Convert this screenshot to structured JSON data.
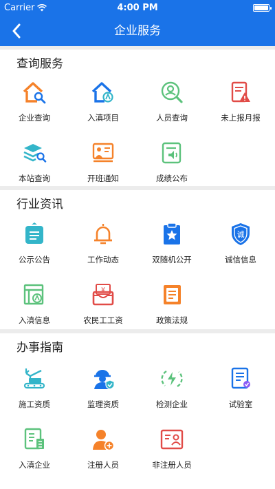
{
  "status_bar": {
    "carrier": "Carrier",
    "time": "4:00 PM"
  },
  "nav": {
    "title": "企业服务",
    "back_icon": "chevron-left-icon"
  },
  "sections": [
    {
      "title": "查询服务",
      "items": [
        {
          "label": "企业查询",
          "icon": "house-search-icon"
        },
        {
          "label": "入滇项目",
          "icon": "house-project-icon"
        },
        {
          "label": "人员查询",
          "icon": "person-search-icon"
        },
        {
          "label": "未上报月报",
          "icon": "report-alert-icon"
        },
        {
          "label": "本站查询",
          "icon": "layers-search-icon"
        },
        {
          "label": "开班通知",
          "icon": "class-board-icon"
        },
        {
          "label": "成绩公布",
          "icon": "score-announce-icon"
        }
      ]
    },
    {
      "title": "行业资讯",
      "items": [
        {
          "label": "公示公告",
          "icon": "notice-board-icon"
        },
        {
          "label": "工作动态",
          "icon": "bell-icon"
        },
        {
          "label": "双随机公开",
          "icon": "star-clipboard-icon"
        },
        {
          "label": "诚信信息",
          "icon": "shield-integrity-icon"
        },
        {
          "label": "入滇信息",
          "icon": "entry-info-icon"
        },
        {
          "label": "农民工工资",
          "icon": "wage-wallet-icon"
        },
        {
          "label": "政策法规",
          "icon": "policy-book-icon"
        }
      ]
    },
    {
      "title": "办事指南",
      "items": [
        {
          "label": "施工资质",
          "icon": "crane-icon"
        },
        {
          "label": "监理资质",
          "icon": "worker-helmet-icon"
        },
        {
          "label": "检测企业",
          "icon": "energy-check-icon"
        },
        {
          "label": "试验室",
          "icon": "lab-document-icon"
        },
        {
          "label": "入滇企业",
          "icon": "enterprise-doc-icon"
        },
        {
          "label": "注册人员",
          "icon": "add-person-icon"
        },
        {
          "label": "非注册人员",
          "icon": "id-card-icon"
        }
      ]
    }
  ],
  "colors": {
    "primary": "#1a73e8",
    "orange": "#f5822a",
    "teal": "#33b5c9",
    "green": "#5cc27c",
    "red": "#e14b47"
  }
}
